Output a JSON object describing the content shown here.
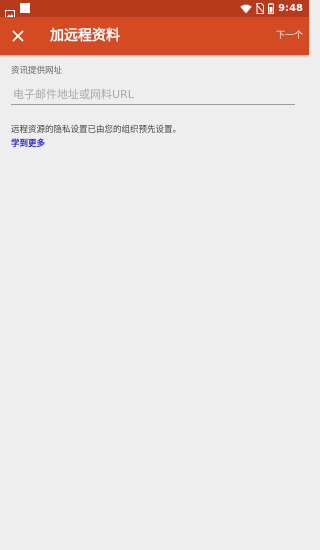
{
  "status_bar": {
    "time": "9:48",
    "left_icons": [
      "image-notification-icon",
      "square-notification-icon"
    ],
    "right_icons": [
      "wifi-icon",
      "no-sim-icon",
      "battery-icon"
    ],
    "color": "#b83a1d"
  },
  "app_bar": {
    "close_icon": "close-icon",
    "title": "加远程资料",
    "next_label": "下一个",
    "color": "#d44b23"
  },
  "form": {
    "field_label": "资讯提供网址",
    "url_placeholder": "电子邮件地址或网料URL",
    "url_value": ""
  },
  "privacy": {
    "text": "远程资源的隐私设置已由您的组织预先设置。",
    "learn_more": "学到更多",
    "link_color": "#2f2fd9"
  }
}
